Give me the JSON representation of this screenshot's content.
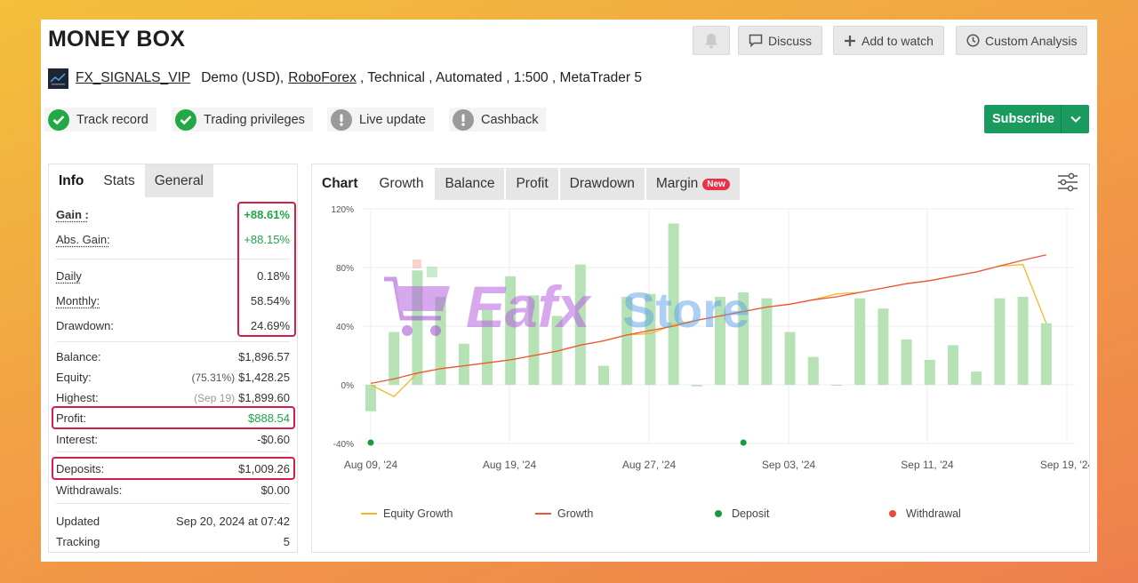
{
  "header": {
    "title": "MONEY BOX",
    "buttons": {
      "discuss": "Discuss",
      "add_to_watch": "Add to watch",
      "custom_analysis": "Custom Analysis"
    }
  },
  "account": {
    "name": "FX_SIGNALS_VIP",
    "type": "Demo (USD),",
    "broker": "RoboForex",
    "details": ", Technical , Automated , 1:500 , MetaTrader 5"
  },
  "badges": {
    "track_record": "Track record",
    "trading_privileges": "Trading privileges",
    "live_update": "Live update",
    "cashback": "Cashback"
  },
  "subscribe_label": "Subscribe",
  "left_tabs": {
    "info": "Info",
    "stats": "Stats",
    "general": "General"
  },
  "stats": {
    "gain_label": "Gain :",
    "gain": "+88.61%",
    "abs_gain_label": "Abs. Gain:",
    "abs_gain": "+88.15%",
    "daily_label": "Daily",
    "daily": "0.18%",
    "monthly_label": "Monthly:",
    "monthly": "58.54%",
    "drawdown_label": "Drawdown:",
    "drawdown": "24.69%",
    "balance_label": "Balance:",
    "balance": "$1,896.57",
    "equity_label": "Equity:",
    "equity_pct": "(75.31%)",
    "equity": "$1,428.25",
    "highest_label": "Highest:",
    "highest_date": "(Sep 19)",
    "highest": "$1,899.60",
    "profit_label": "Profit:",
    "profit": "$888.54",
    "interest_label": "Interest:",
    "interest": "-$0.60",
    "deposits_label": "Deposits:",
    "deposits": "$1,009.26",
    "withdrawals_label": "Withdrawals:",
    "withdrawals": "$0.00",
    "updated_label": "Updated",
    "updated": "Sep 20, 2024 at 07:42",
    "tracking_label": "Tracking",
    "tracking": "5"
  },
  "chart_tabs": {
    "chart": "Chart",
    "growth": "Growth",
    "balance": "Balance",
    "profit": "Profit",
    "drawdown": "Drawdown",
    "margin": "Margin",
    "new_badge": "New"
  },
  "watermark": {
    "text_a": "Eafx",
    "text_b": "Store"
  },
  "colors": {
    "growth_line": "#e8573a",
    "equity_line": "#f5b821",
    "bars": "#b6e2b6",
    "deposit": "#1a9a3c",
    "withdrawal": "#e64b3c",
    "accent": "#1a9a5e",
    "highlight": "#d41e4a"
  },
  "chart_data": {
    "type": "bar",
    "ylim": [
      -40,
      120
    ],
    "y_ticks": [
      -40,
      0,
      40,
      80,
      120
    ],
    "y_tick_labels": [
      "-40%",
      "0%",
      "40%",
      "80%",
      "120%"
    ],
    "x_tick_labels": [
      "Aug 09, '24",
      "Aug 19, '24",
      "Aug 27, '24",
      "Sep 03, '24",
      "Sep 11, '24",
      "Sep 19, '24"
    ],
    "bar_values": [
      -18,
      36,
      78,
      60,
      28,
      51,
      74,
      61,
      47,
      82,
      13,
      60,
      62,
      110,
      -1,
      60,
      63,
      59,
      36,
      19,
      0,
      59,
      52,
      31,
      17,
      27,
      9,
      59,
      60,
      42
    ],
    "growth": [
      1,
      4,
      8,
      11,
      13,
      15,
      17,
      20,
      23,
      27,
      30,
      34,
      37,
      40,
      44,
      47,
      50,
      53,
      55,
      58,
      60,
      63,
      66,
      69,
      71,
      74,
      77,
      81,
      85,
      88.61
    ],
    "equity_growth": [
      0,
      -8,
      8,
      11,
      13,
      15,
      17,
      20,
      23,
      27,
      30,
      34,
      35,
      41,
      44,
      47,
      50,
      53,
      55,
      58,
      62,
      63,
      66,
      69,
      71,
      74,
      77,
      81,
      82,
      42
    ],
    "deposit_indices": [
      0,
      16
    ],
    "legend": [
      "Equity Growth",
      "Growth",
      "Deposit",
      "Withdrawal"
    ]
  }
}
